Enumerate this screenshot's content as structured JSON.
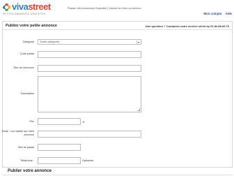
{
  "header": {
    "logo_part1": "viva",
    "logo_part2": "street",
    "logo_tagline": "PETITES ANNONCES GRATUITES",
    "tagline": "Passer des Annonces Gratuites | Vendre un bien ou service",
    "links": [
      "Mon compte",
      "Aide"
    ]
  },
  "panel": {
    "title": "Publier votre petite annonce",
    "question": "Une question ? Contactez notre service client au 01.84.88.83.76"
  },
  "form": {
    "category_label": "Catégorie",
    "category_value": "Toutes catégories",
    "postal_label": "Code postal",
    "title_label": "Titre de l'annonce",
    "description_label": "Description",
    "price_label": "Prix",
    "currency": "€",
    "email_label": "Email : non visible sur votre annonce",
    "password_label": "Mot de passe",
    "phone_label": "Téléphone :",
    "optional": "Optionnel"
  },
  "section": {
    "title": "Publier votre annonce"
  }
}
